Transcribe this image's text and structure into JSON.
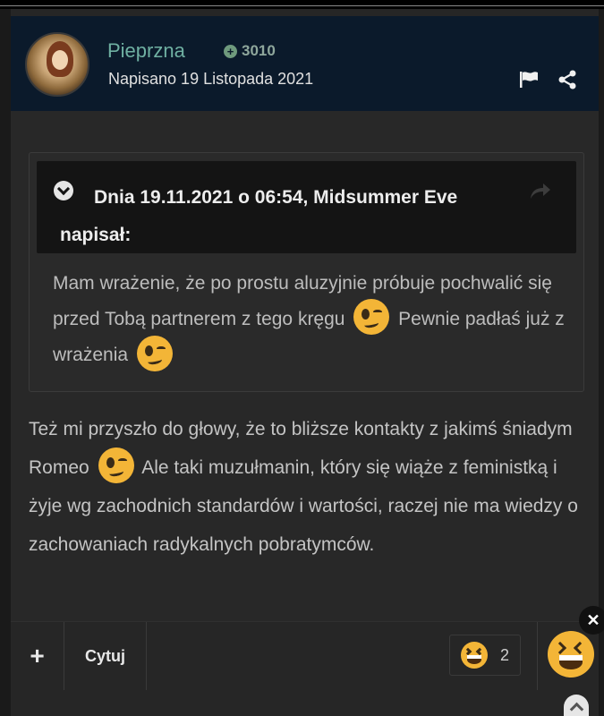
{
  "author": {
    "username": "Pieprzna",
    "reputation": "3010",
    "posted": "Napisano 19 Listopada 2021"
  },
  "quote": {
    "header_line1": "Dnia 19.11.2021 o 06:54, Midsummer Eve",
    "header_line2": "napisał:",
    "text_part1": "Mam wrażenie, że po prostu aluzyjnie próbuje pochwalić się przed Tobą partnerem z tego kręgu",
    "text_part2": "Pewnie padłaś już z wrażenia"
  },
  "post": {
    "text_part1": "Też mi przyszło do głowy, że to bliższe kontakty z jakimś śniadym Romeo",
    "text_part2": "Ale taki muzułmanin, który się wiąże z feministką i żyje wg zachodnich standardów i wartości, raczej nie ma wiedzy o zachowaniach radykalnych pobratymców."
  },
  "footer": {
    "add_label": "+",
    "quote_label": "Cytuj",
    "reaction_count": "2"
  },
  "colors": {
    "header_bg": "#0b1a2b",
    "username": "#6fb0a2",
    "emoji": "#f3b537"
  },
  "icons": [
    "flag-icon",
    "share-icon",
    "chevron-down-icon",
    "jump-to-quote-icon",
    "wink-emoji-icon",
    "laughing-emoji-icon",
    "close-icon",
    "chevron-up-icon"
  ]
}
